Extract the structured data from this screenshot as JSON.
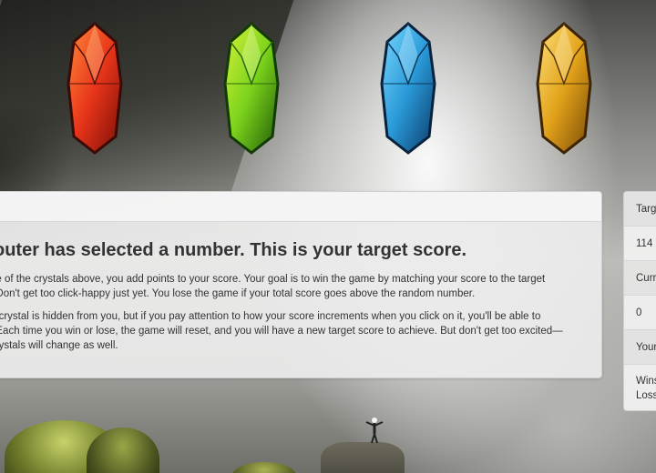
{
  "crystals": [
    {
      "name": "red-crystal",
      "color": "#e8351a"
    },
    {
      "name": "green-crystal",
      "color": "#7bd21b"
    },
    {
      "name": "blue-crystal",
      "color": "#2a9ad8"
    },
    {
      "name": "yellow-crystal",
      "color": "#e2a21a"
    }
  ],
  "instructions": {
    "title": "outer has selected a number. This is your target score.",
    "para1_line1": "ne of the crystals above, you add points to your score. Your goal is to win the game by matching your score to the target",
    "para1_line2": "! Don't get too click-happy just yet. You lose the game if your total score goes above the random number.",
    "para2_line1": "h crystal is hidden from you, but if you pay attention to how your score increments when you click on it, you'll be able to",
    "para2_line2": ". Each time you win or lose, the game will reset, and you will have a new target score to achieve. But don't get too excited—",
    "para2_line3": "crystals will change as well."
  },
  "scoreboard": {
    "target_label": "Targ",
    "target_value": "114",
    "current_label": "Curr",
    "current_value": "0",
    "your_label": "Your",
    "wins_label": "Wins",
    "losses_label": "Loss"
  }
}
